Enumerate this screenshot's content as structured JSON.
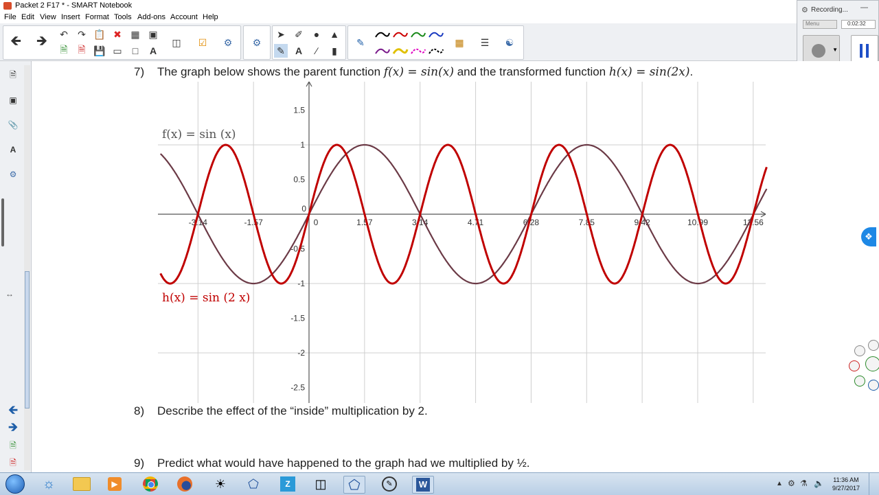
{
  "window": {
    "title": "Packet 2 F17 * - SMART Notebook"
  },
  "menu": [
    "File",
    "Edit",
    "View",
    "Insert",
    "Format",
    "Tools",
    "Add-ons",
    "Account",
    "Help"
  ],
  "recorder": {
    "status": "Recording...",
    "menu_label": "Menu",
    "time": "0:02:32"
  },
  "page": {
    "q7": {
      "number": "7)",
      "text_a": "The graph below shows the parent function ",
      "f_expr": "f(x) = sin(x)",
      "text_b": " and the transformed function ",
      "h_expr": "h(x) = sin(2x)",
      "text_c": "."
    },
    "q8": {
      "number": "8)",
      "text": "Describe the effect of the “inside” multiplication by 2."
    },
    "q9": {
      "number": "9)",
      "text": "Predict what would have happened to the graph had we multiplied by ½."
    }
  },
  "chart_data": {
    "type": "line",
    "x_range": [
      -2.7,
      8.3
    ],
    "y_range": [
      -2.7,
      1.9
    ],
    "x_ticks": [
      -3.14,
      -1.57,
      0,
      1.57,
      3.14,
      4.71,
      6.28,
      7.85,
      9.42,
      10.99,
      12.56
    ],
    "x_tick_labels": [
      "-3.14",
      "-1.57",
      "0",
      "1.57",
      "3.14",
      "4.71",
      "6.28",
      "7.85",
      "9.42",
      "10.99",
      "12.56"
    ],
    "y_ticks": [
      1.5,
      1,
      0.5,
      0,
      -0.5,
      -1,
      -1.5,
      -2,
      -2.5
    ],
    "y_tick_labels": [
      "1.5",
      "1",
      "0.5",
      "0",
      "-0.5",
      "-1",
      "-1.5",
      "-2",
      "-2.5"
    ],
    "grid": true,
    "series": [
      {
        "name": "f(x) = sin (x)",
        "formula": "sin(x)",
        "color": "#6b3a46",
        "x_min": -4.2,
        "x_max": 13.0
      },
      {
        "name": "h(x) = sin (2 x)",
        "formula": "sin(2x)",
        "color": "#c00000",
        "x_min": -4.2,
        "x_max": 13.0
      }
    ],
    "xlabel": "",
    "ylabel": ""
  },
  "taskbar": {
    "time": "11:36 AM",
    "date": "9/27/2017"
  }
}
